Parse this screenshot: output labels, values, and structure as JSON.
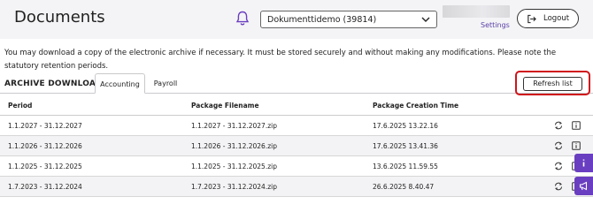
{
  "header": {
    "title": "Documents",
    "company_select": "Dokumenttidemo (39814)",
    "settings_label": "Settings",
    "logout_label": "Logout"
  },
  "notice": "You may download a copy of the electronic archive if necessary. It must be stored securely and without making any modifications. Please note the statutory retention periods.",
  "archive": {
    "label": "ARCHIVE DOWNLOAD",
    "tabs": [
      {
        "label": "Accounting",
        "active": true
      },
      {
        "label": "Payroll",
        "active": false
      }
    ],
    "refresh_label": "Refresh list"
  },
  "table": {
    "columns": [
      "Period",
      "Package Filename",
      "Package Creation Time"
    ],
    "rows": [
      {
        "period": "1.1.2027 - 31.12.2027",
        "filename": "1.1.2027 - 31.12.2027.zip",
        "created": "17.6.2025 13.22.16"
      },
      {
        "period": "1.1.2026 - 31.12.2026",
        "filename": "1.1.2026 - 31.12.2026.zip",
        "created": "17.6.2025 13.41.36"
      },
      {
        "period": "1.1.2025 - 31.12.2025",
        "filename": "1.1.2025 - 31.12.2025.zip",
        "created": "13.6.2025 11.59.55"
      },
      {
        "period": "1.7.2023 - 31.12.2024",
        "filename": "1.7.2023 - 31.12.2024.zip",
        "created": "26.6.2025 8.40.47"
      }
    ]
  },
  "icons": {
    "notifications": "bell-icon",
    "dropdown": "chevron-down-icon",
    "logout": "logout-icon",
    "row_refresh": "refresh-icon",
    "row_info": "info-icon",
    "help": "info-icon",
    "feedback": "megaphone-icon"
  },
  "colors": {
    "accent": "#6a3ec0",
    "highlight": "#d0141a",
    "header_bg": "#f4f4f6",
    "row_alt": "#f3f3f5"
  }
}
